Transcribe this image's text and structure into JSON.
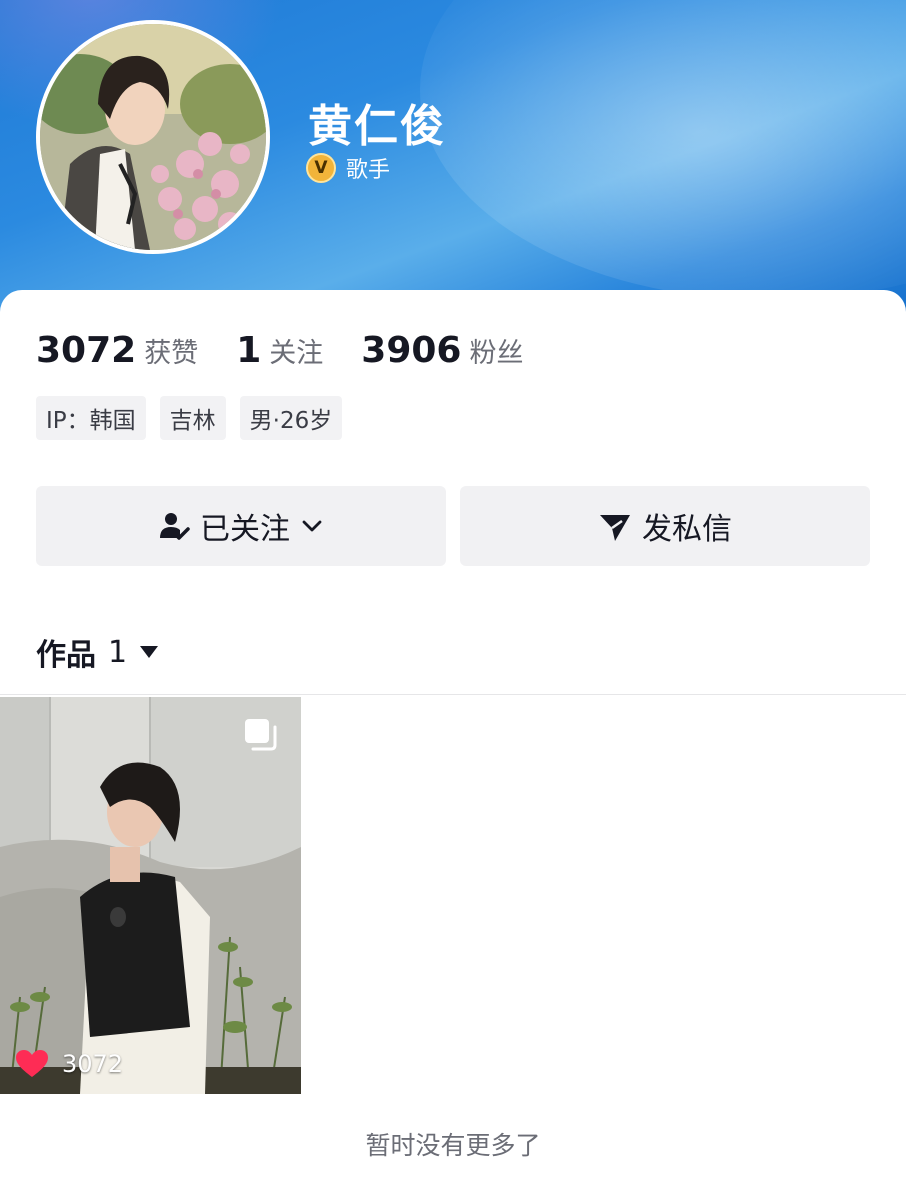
{
  "profile": {
    "name": "黄仁俊",
    "verify_badge": "V",
    "verify_label": "歌手",
    "avatar_icon": "avatar-photo"
  },
  "stats": [
    {
      "value": "3072",
      "label": "获赞"
    },
    {
      "value": "1",
      "label": "关注"
    },
    {
      "value": "3906",
      "label": "粉丝"
    }
  ],
  "tags": [
    "IP：韩国",
    "吉林",
    "男·26岁"
  ],
  "buttons": {
    "follow_label": "已关注",
    "message_label": "发私信"
  },
  "works": {
    "label": "作品",
    "count": "1"
  },
  "posts": [
    {
      "likes": "3072",
      "icon": "heart-icon",
      "multi_icon": "carousel-icon"
    }
  ],
  "footer": "暂时没有更多了",
  "colors": {
    "banner": "#2b8ae0",
    "button_bg": "#f1f1f3",
    "heart": "#fe2c55",
    "badge": "#f2b43a"
  }
}
